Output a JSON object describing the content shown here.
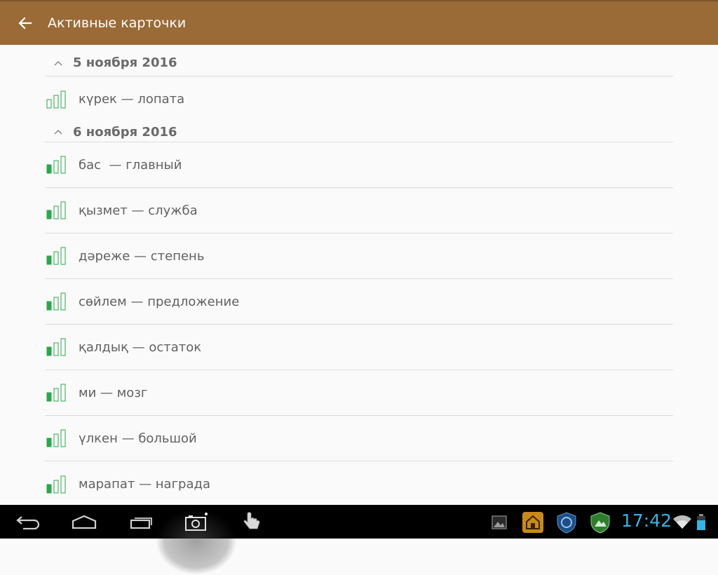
{
  "appbar": {
    "title": "Активные карточки",
    "back_icon": "arrow-left-icon",
    "color": "#9a6a37"
  },
  "sections": [
    {
      "date": "5 ноября 2016",
      "cards": [
        {
          "text": "күрек — лопата",
          "level": 0
        }
      ]
    },
    {
      "date": "6 ноября 2016",
      "cards": [
        {
          "text": "бас  — главный",
          "level": 1
        },
        {
          "text": "қызмет — служба",
          "level": 1
        },
        {
          "text": "дәреже — степень",
          "level": 1
        },
        {
          "text": "сөйлем — предложение",
          "level": 1
        },
        {
          "text": "қалдық — остаток",
          "level": 1
        },
        {
          "text": "ми — мозг",
          "level": 1
        },
        {
          "text": "үлкен — большой",
          "level": 1
        },
        {
          "text": "марапат — награда",
          "level": 1
        }
      ]
    }
  ],
  "level_max": 3,
  "level_color": "#2aa84a",
  "status_bar": {
    "time": "17:42",
    "clock_color": "#33b5e5"
  }
}
